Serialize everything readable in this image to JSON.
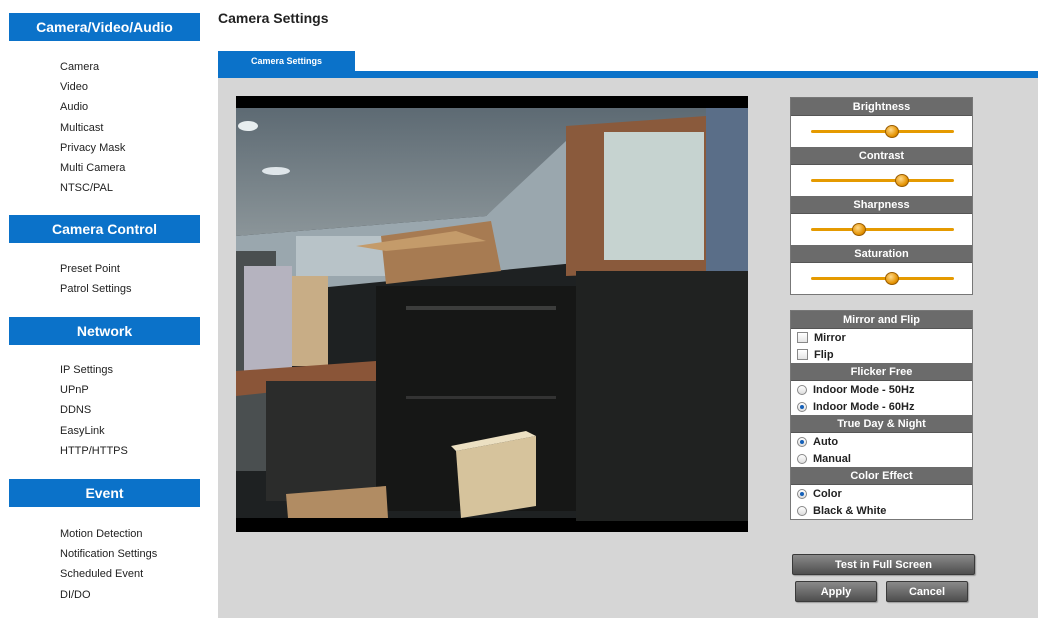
{
  "sidebar": {
    "sections": [
      {
        "title": "Camera/Video/Audio",
        "items": [
          "Camera",
          "Video",
          "Audio",
          "Multicast",
          "Privacy Mask",
          "Multi Camera",
          "NTSC/PAL"
        ]
      },
      {
        "title": "Camera Control",
        "items": [
          "Preset Point",
          "Patrol Settings"
        ]
      },
      {
        "title": "Network",
        "items": [
          "IP Settings",
          "UPnP",
          "DDNS",
          "EasyLink",
          "HTTP/HTTPS"
        ]
      },
      {
        "title": "Event",
        "items": [
          "Motion Detection",
          "Notification Settings",
          "Scheduled Event",
          "DI/DO"
        ]
      }
    ]
  },
  "page_title": "Camera Settings",
  "tab_label": "Camera Settings",
  "image_controls": {
    "brightness": {
      "label": "Brightness",
      "level": 0.56
    },
    "contrast": {
      "label": "Contrast",
      "level": 0.63
    },
    "sharpness": {
      "label": "Sharpness",
      "level": 0.33
    },
    "saturation": {
      "label": "Saturation",
      "level": 0.56
    }
  },
  "mirror_flip": {
    "title": "Mirror and Flip",
    "mirror_label": "Mirror",
    "mirror_checked": false,
    "flip_label": "Flip",
    "flip_checked": false
  },
  "flicker_free": {
    "title": "Flicker Free",
    "options": [
      {
        "label": "Indoor Mode - 50Hz",
        "selected": false
      },
      {
        "label": "Indoor Mode - 60Hz",
        "selected": true
      }
    ]
  },
  "day_night": {
    "title": "True Day & Night",
    "options": [
      {
        "label": "Auto",
        "selected": true
      },
      {
        "label": "Manual",
        "selected": false
      }
    ]
  },
  "color_effect": {
    "title": "Color Effect",
    "options": [
      {
        "label": "Color",
        "selected": true
      },
      {
        "label": "Black & White",
        "selected": false
      }
    ]
  },
  "buttons": {
    "test_full_screen": "Test in Full Screen",
    "apply": "Apply",
    "cancel": "Cancel"
  },
  "colors": {
    "accent": "#0b72c9",
    "panel_header": "#6b6b6b",
    "slider": "#e59a00"
  }
}
